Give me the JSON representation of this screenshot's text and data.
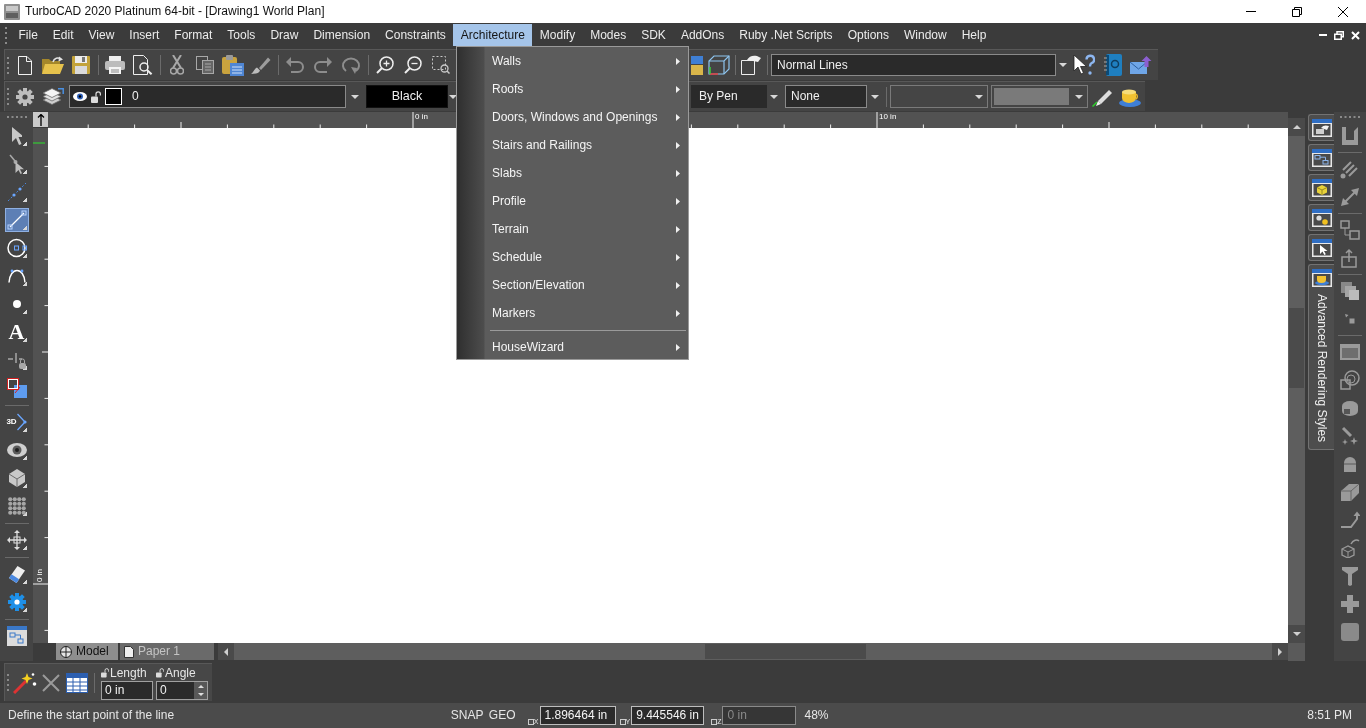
{
  "window": {
    "title": "TurboCAD 2020 Platinum 64-bit - [Drawing1 World Plan]"
  },
  "menu_bar": [
    {
      "label": "File",
      "selected": false
    },
    {
      "label": "Edit",
      "selected": false
    },
    {
      "label": "View",
      "selected": false
    },
    {
      "label": "Insert",
      "selected": false
    },
    {
      "label": "Format",
      "selected": false
    },
    {
      "label": "Tools",
      "selected": false
    },
    {
      "label": "Draw",
      "selected": false
    },
    {
      "label": "Dimension",
      "selected": false
    },
    {
      "label": "Constraints",
      "selected": false
    },
    {
      "label": "Architecture",
      "selected": true
    },
    {
      "label": "Modify",
      "selected": false
    },
    {
      "label": "Modes",
      "selected": false
    },
    {
      "label": "SDK",
      "selected": false
    },
    {
      "label": "AddOns",
      "selected": false
    },
    {
      "label": "Ruby .Net Scripts",
      "selected": false
    },
    {
      "label": "Options",
      "selected": false
    },
    {
      "label": "Window",
      "selected": false
    },
    {
      "label": "Help",
      "selected": false
    }
  ],
  "architecture_menu": [
    {
      "kind": "item",
      "label": "Walls"
    },
    {
      "kind": "item",
      "label": "Roofs"
    },
    {
      "kind": "item",
      "label": "Doors, Windows and Openings"
    },
    {
      "kind": "item",
      "label": "Stairs and Railings"
    },
    {
      "kind": "item",
      "label": "Slabs"
    },
    {
      "kind": "item",
      "label": "Profile"
    },
    {
      "kind": "item",
      "label": "Terrain"
    },
    {
      "kind": "item",
      "label": "Schedule"
    },
    {
      "kind": "item",
      "label": "Section/Elevation"
    },
    {
      "kind": "item",
      "label": "Markers"
    },
    {
      "kind": "separator"
    },
    {
      "kind": "item",
      "label": "HouseWizard"
    }
  ],
  "standard_toolbar": {
    "line_style_combo": "Normal Lines"
  },
  "property_toolbar": {
    "layer_combo": "0",
    "color_combo": "Black",
    "combo_3": "By Pen",
    "combo_4": "None"
  },
  "rulers": {
    "horizontal_labels": [
      "0 in",
      "10 in"
    ],
    "vertical_labels": [
      "0 in"
    ]
  },
  "left_toolbar": [
    {
      "selected": false
    },
    {
      "selected": false
    },
    {
      "selected": false
    },
    {
      "selected": true
    },
    {
      "selected": false
    },
    {
      "selected": false
    },
    {
      "selected": false
    },
    {
      "selected": false,
      "text": "A"
    },
    {
      "selected": false
    },
    {
      "selected": false
    },
    {
      "selected": false,
      "text": "3D"
    },
    {
      "selected": false
    },
    {
      "selected": false
    },
    {
      "selected": false
    },
    {
      "selected": false
    },
    {
      "selected": false
    },
    {
      "selected": false
    },
    {
      "selected": false
    }
  ],
  "palette_tabs": [
    {
      "expanded": false
    },
    {
      "expanded": false
    },
    {
      "expanded": false
    },
    {
      "expanded": false
    },
    {
      "expanded": false
    },
    {
      "expanded": true,
      "label": "Advanced Rendering Styles"
    }
  ],
  "drawing_tabs": [
    {
      "label": "Model",
      "selected": true
    },
    {
      "label": "Paper 1",
      "selected": false
    }
  ],
  "inspector_bar": {
    "fields": [
      {
        "kind": "text",
        "label": "Length",
        "value": "0 in"
      },
      {
        "kind": "spin",
        "label": "Angle",
        "value": "0"
      }
    ]
  },
  "status_bar": {
    "message": "Define the start point of the line",
    "modes": [
      "SNAP",
      "GEO"
    ],
    "coordinates": [
      {
        "axis": "X",
        "value": "1.896464 in",
        "disabled": false
      },
      {
        "axis": "Y",
        "value": "9.445546 in",
        "disabled": false
      },
      {
        "axis": "Z",
        "value": "0 in",
        "disabled": true
      }
    ],
    "zoom": "48%",
    "time": "8:51 PM"
  }
}
